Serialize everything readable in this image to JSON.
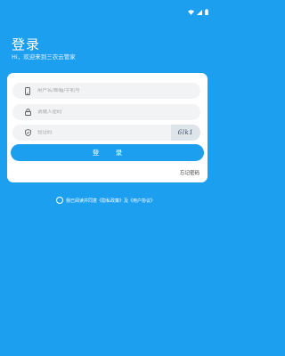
{
  "header": {
    "title": "登录",
    "subtitle": "Hi，欢迎来到三农云管家"
  },
  "form": {
    "username_placeholder": "用户名/邮箱/手机号",
    "password_placeholder": "请输入密码",
    "captcha_placeholder": "验证码",
    "captcha_text": "6lk1",
    "login_label": "登 录",
    "forgot_label": "忘记密码"
  },
  "agreement": {
    "prefix": "我已阅读并同意",
    "privacy": "《隐私政策》",
    "and": "及",
    "terms": "《用户协议》"
  },
  "colors": {
    "brand": "#1d9ff0"
  }
}
